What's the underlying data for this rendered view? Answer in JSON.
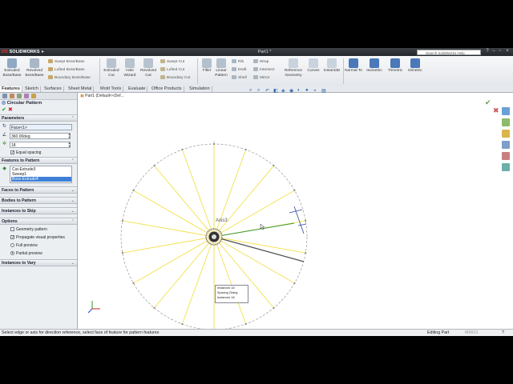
{
  "app": {
    "logo_text": "SOLIDWORKS",
    "document_title": "Part1 *",
    "search_placeholder": "Search SolidWorks Help"
  },
  "command_manager": {
    "big": [
      {
        "id": "extruded-boss",
        "label": "Extruded Boss/Base",
        "icon": "extruded-boss-icon"
      },
      {
        "id": "revolved-boss",
        "label": "Revolved Boss/Base",
        "icon": "revolved-boss-icon"
      },
      {
        "id": "extruded-cut",
        "label": "Extruded Cut",
        "icon": "extruded-cut-icon"
      },
      {
        "id": "hole-wizard",
        "label": "Hole Wizard",
        "icon": "hole-wizard-icon"
      },
      {
        "id": "revolved-cut",
        "label": "Revolved Cut",
        "icon": "revolved-cut-icon"
      },
      {
        "id": "fillet",
        "label": "Fillet",
        "icon": "fillet-icon"
      },
      {
        "id": "linear-pattern",
        "label": "Linear Pattern",
        "icon": "linear-pattern-icon"
      },
      {
        "id": "reference-geometry",
        "label": "Reference Geometry",
        "icon": "reference-geometry-icon"
      },
      {
        "id": "curves",
        "label": "Curves",
        "icon": "curves-icon"
      },
      {
        "id": "instant3d",
        "label": "Instant3D",
        "icon": "instant3d-icon"
      },
      {
        "id": "normal-to",
        "label": "Normal To",
        "icon": "normal-to-icon"
      },
      {
        "id": "isometric",
        "label": "Isometric",
        "icon": "isometric-icon"
      },
      {
        "id": "trimetric",
        "label": "Trimetric",
        "icon": "trimetric-icon"
      },
      {
        "id": "dimetric",
        "label": "Dimetric",
        "icon": "dimetric-icon"
      }
    ],
    "small": {
      "swept_boss": "Swept Boss/Base",
      "lofted_boss": "Lofted Boss/Base",
      "boundary_boss": "Boundary Boss/Base",
      "swept_cut": "Swept Cut",
      "lofted_cut": "Lofted Cut",
      "boundary_cut": "Boundary Cut",
      "rib": "Rib",
      "draft": "Draft",
      "shell": "Shell",
      "wrap": "Wrap",
      "intersect": "Intersect",
      "mirror": "Mirror"
    }
  },
  "tabs": [
    "Features",
    "Sketch",
    "Surfaces",
    "Sheet Metal",
    "Mold Tools",
    "Evaluate",
    "Office Products",
    "Simulation"
  ],
  "panel": {
    "title": "Circular Pattern",
    "parameters_label": "Parameters",
    "axis_value": "Face<1>",
    "angle_value": "360.00deg",
    "instances_value": "18",
    "equal_spacing_label": "Equal spacing",
    "features_to_pattern_label": "Features to Pattern",
    "features": [
      "Cut-Extrude3",
      "Sweep1",
      "Boss-Extrude4"
    ],
    "faces_to_pattern_label": "Faces to Pattern",
    "bodies_to_pattern_label": "Bodies to Pattern",
    "instances_to_skip_label": "Instances to Skip",
    "options_label": "Options",
    "geometry_pattern_label": "Geometry pattern",
    "propagate_label": "Propagate visual properties",
    "full_preview_label": "Full preview",
    "partial_preview_label": "Partial preview",
    "instances_to_vary_label": "Instances to Vary"
  },
  "graphics": {
    "breadcrumb": "Part1  (Default<<Def...",
    "axis_label": "Axis3",
    "callout": {
      "row1_label": "Instances",
      "row1_value": "18",
      "row2_label": "Spacing",
      "row2_value": "20deg",
      "row3_label": "Instances",
      "row3_value": "18"
    }
  },
  "status": {
    "message": "Select edge or axis for direction reference, select face of feature for pattern features",
    "mode": "Editing Part",
    "units": "MMGS"
  },
  "colors": {
    "yellow_spokes": "#f3e14a",
    "selection_blue": "#3d80d6",
    "preview_green": "#3c9a3c"
  }
}
